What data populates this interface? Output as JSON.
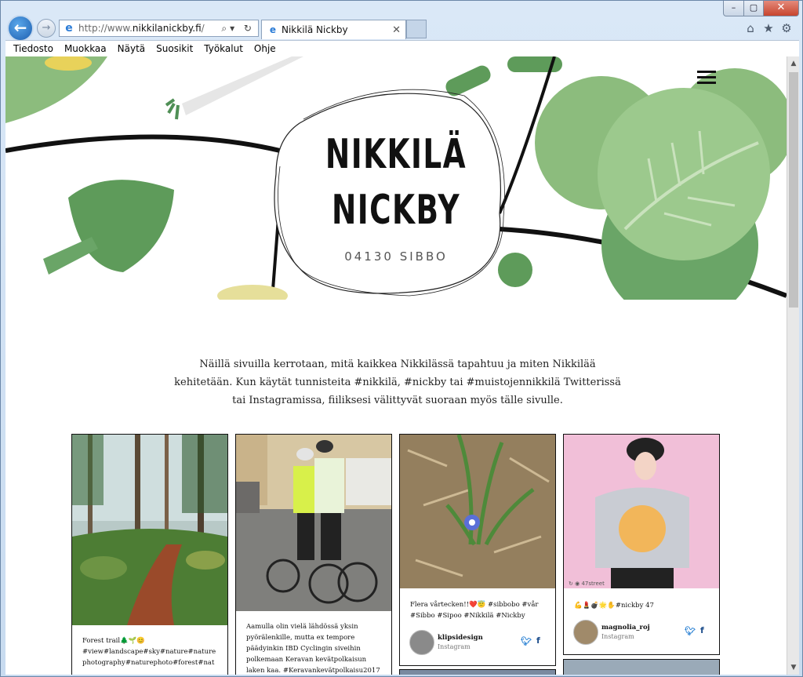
{
  "browser": {
    "window_controls": {
      "minimize": "–",
      "maximize": "▢",
      "close": "✕"
    },
    "back_icon": "arrow-left-icon",
    "forward_icon": "arrow-right-icon",
    "address": {
      "prefix": "http://www.",
      "host": "nikkilanickby.fi",
      "suffix": "/"
    },
    "address_tools": "⌕▾ ↻",
    "tab": {
      "title": "Nikkilä Nickby",
      "close": "✕"
    },
    "toolbar_icons": [
      "home-icon",
      "favorites-icon",
      "settings-icon"
    ],
    "menu": [
      "Tiedosto",
      "Muokkaa",
      "Näytä",
      "Suosikit",
      "Työkalut",
      "Ohje"
    ]
  },
  "page": {
    "logo": {
      "line1": "NIKKILÄ",
      "line2": "NICKBY",
      "subtitle": "04130 SIBBO"
    },
    "intro": "Näillä sivuilla kerrotaan, mitä kaikkea Nikkilässä tapahtuu ja miten Nikkilää kehitetään. Kun käytät tunnisteita #nikkilä, #nickby tai #muistojennikkilä Twitterissä tai Instagramissa, fiiliksesi välittyvät suoraan myös tälle sivulle.",
    "cards": [
      {
        "caption": "Forest trail🌲🌱😊 #view#landscape#sky#nature#nature photography#naturephoto#forest#nat",
        "username": "",
        "source": ""
      },
      {
        "caption": "Aamulla olin vielä lähdössä yksin pyörälenkille, mutta ex tempore päädyinkin IBD Cyclingin siveihin polkemaan Keravan kevätpolkaisun laken kaa. #Keravankevätpolkaisu2017",
        "username": "",
        "source": ""
      },
      {
        "caption": "Flera vårtecken!!❤️😇 #sibbobo #vår #Sibbo #Sipoo #Nikkilä #Nickby",
        "username": "klipsidesign",
        "source": "Instagram"
      },
      {
        "caption": "💪💄💣🌟✋#nickby 47",
        "username": "magnolia_roj",
        "source": "Instagram",
        "photo_tag": "47street"
      }
    ]
  },
  "colors": {
    "leaf_dark": "#5e9b5a",
    "leaf_light": "#8cbc7d",
    "accent_blue": "#1e7ad1"
  }
}
